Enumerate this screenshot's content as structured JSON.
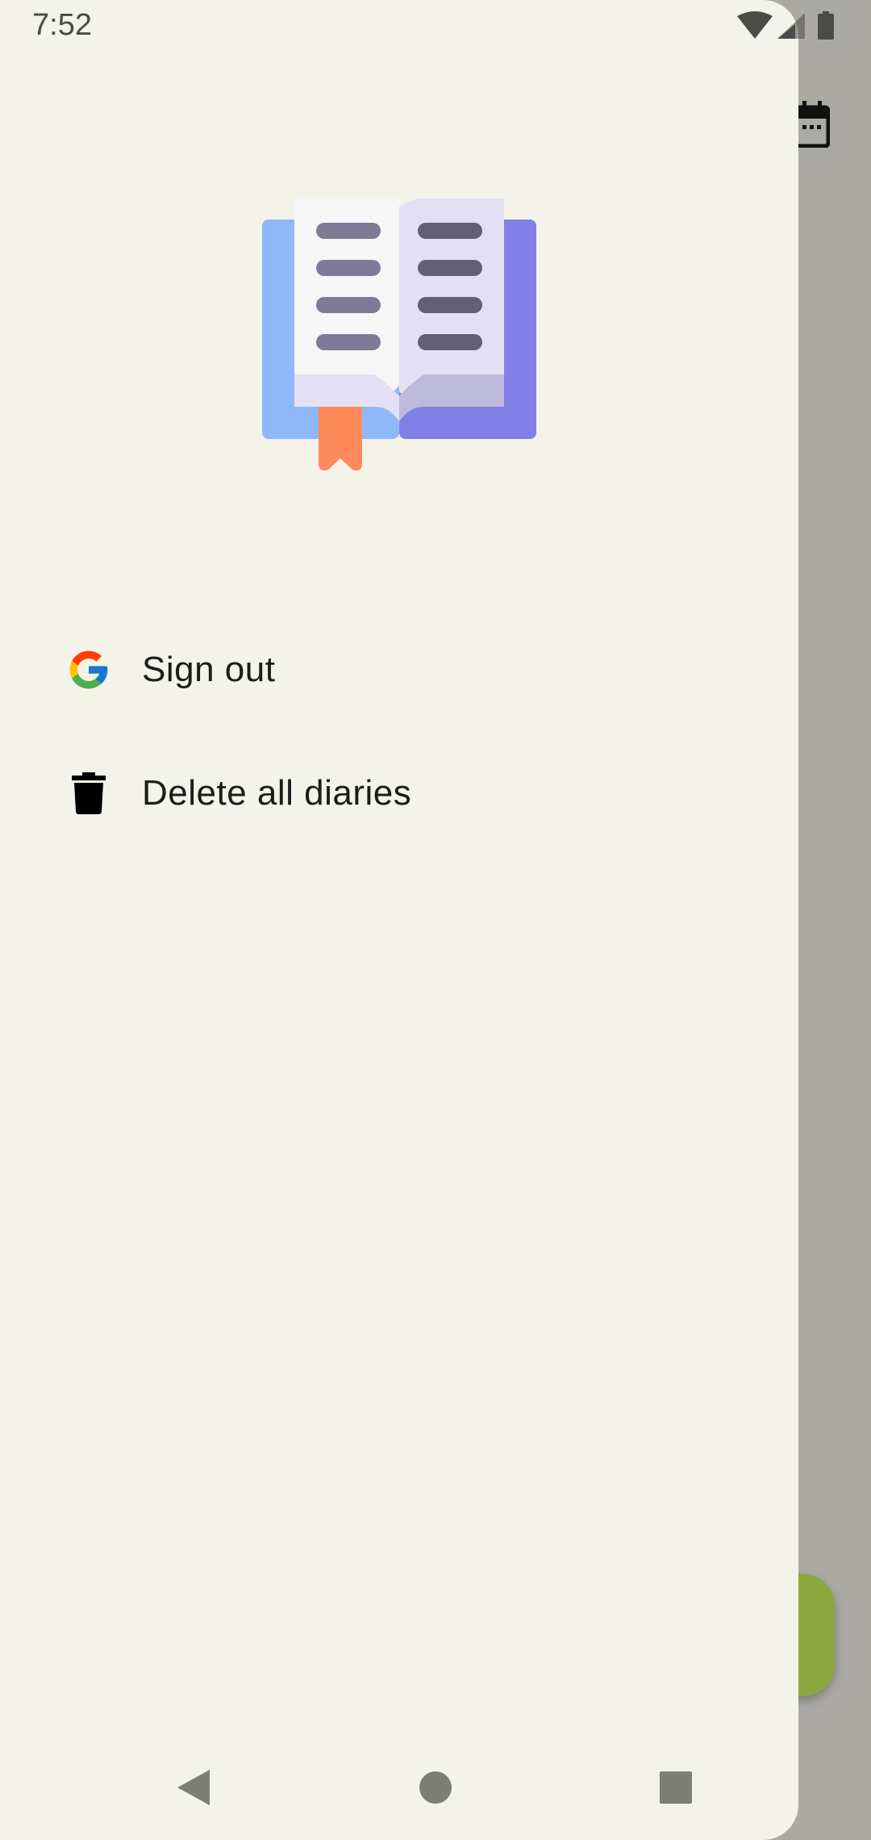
{
  "status_bar": {
    "time": "7:52",
    "icons": [
      "wifi-icon",
      "cellular-signal-icon",
      "battery-icon"
    ]
  },
  "background": {
    "toolbar_icon": "calendar-icon",
    "fab_color": "#8aa83e"
  },
  "drawer": {
    "logo": "open-book-logo",
    "items": [
      {
        "label": "Sign out",
        "icon": "google-icon"
      },
      {
        "label": "Delete all diaries",
        "icon": "trash-icon"
      }
    ]
  },
  "navigation_bar": {
    "buttons": [
      "back-icon",
      "home-icon",
      "recents-icon"
    ]
  },
  "colors": {
    "drawer_background": "#f3f3ea",
    "scrim": "#aaa9a4",
    "accent": "#8aa83e"
  }
}
